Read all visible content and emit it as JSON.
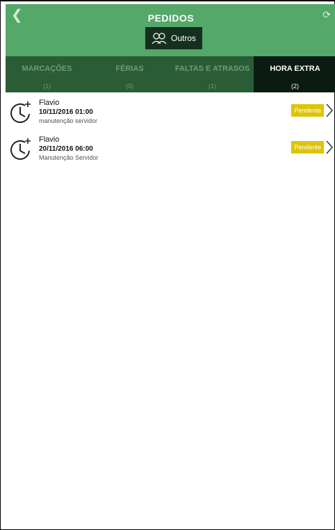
{
  "header": {
    "title": "PEDIDOS",
    "filter_label": "Outros"
  },
  "tabs": [
    {
      "label": "MARCAÇÕES",
      "count": "(1)"
    },
    {
      "label": "FÉRIAS",
      "count": "(0)"
    },
    {
      "label": "FALTAS E ATRASOS",
      "count": "(1)"
    },
    {
      "label": "HORA EXTRA",
      "count": "(2)"
    }
  ],
  "requests": [
    {
      "name": "Flavio",
      "datetime": "10/11/2016  01:00",
      "description": "manutenção servidor",
      "status": "Pendente"
    },
    {
      "name": "Flavio",
      "datetime": "20/11/2016  06:00",
      "description": "Manutenção Servidor",
      "status": "Pendente"
    }
  ],
  "colors": {
    "header": "#54a86a",
    "tabs": "#2a5c36",
    "active_tab": "#0c1b12",
    "badge": "#ddc408"
  },
  "icons": {
    "back": "chevron-left-icon",
    "refresh": "refresh-icon",
    "group": "people-group-icon",
    "clock": "clock-plus-icon",
    "next": "chevron-right-icon"
  }
}
